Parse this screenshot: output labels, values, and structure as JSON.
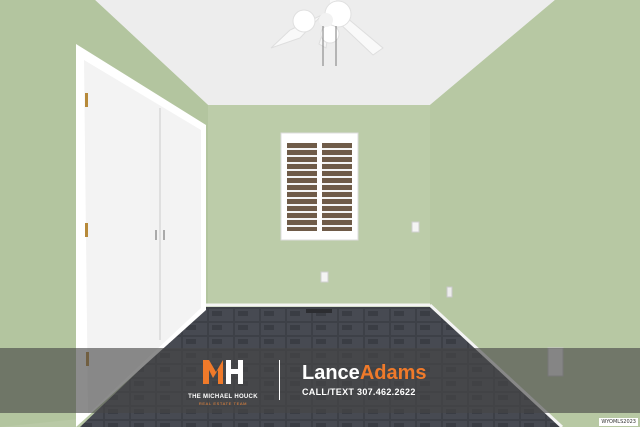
{
  "banner": {
    "logo_brand": "THE MICHAEL HOUCK",
    "logo_tagline": "REAL ESTATE TEAM",
    "agent_first": "Lance",
    "agent_last": "Adams",
    "contact_label": "CALL/TEXT",
    "contact_phone": "307.462.2622"
  },
  "watermark": "WYOMLS2023",
  "colors": {
    "wall": "#b9c9a6",
    "accent_orange": "#f07a2a",
    "floor_tile": "#3b3e44",
    "ceiling": "#ececec"
  },
  "icons": [
    "ceiling-fan-icon",
    "mh-logo-icon",
    "outlet-icon",
    "light-switch-icon"
  ]
}
